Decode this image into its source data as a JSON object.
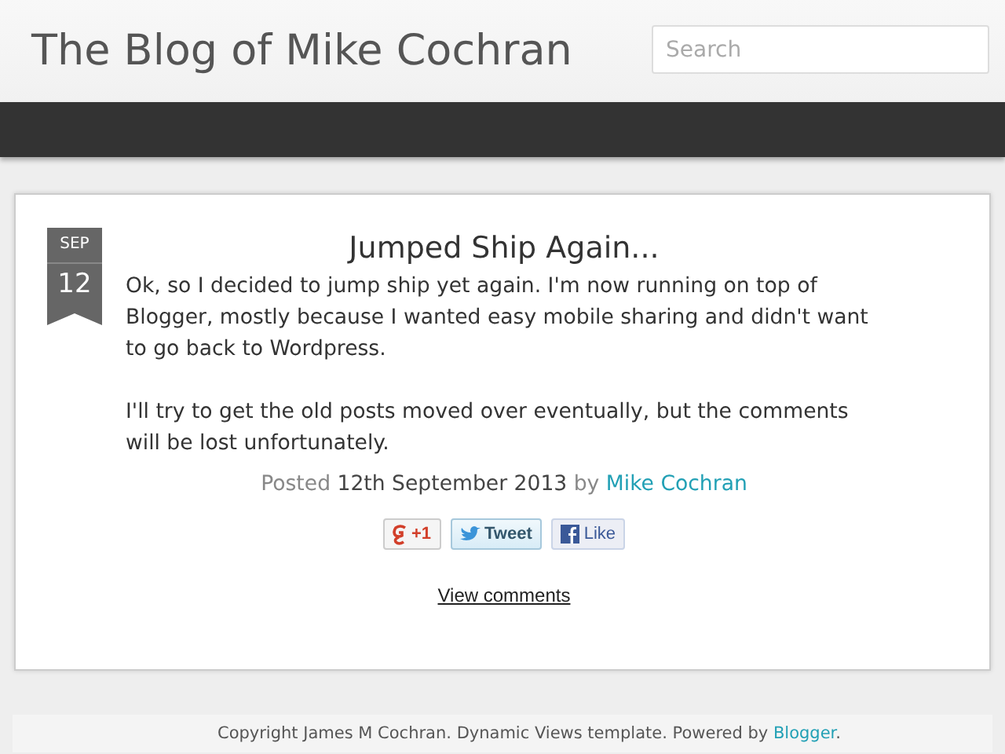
{
  "header": {
    "title": "The Blog of Mike Cochran",
    "search": {
      "placeholder": "Search"
    }
  },
  "post": {
    "date": {
      "month": "SEP",
      "day": "12"
    },
    "title": "Jumped Ship Again...",
    "paragraphs": [
      "Ok, so I decided to jump ship yet again. I'm now running on top of Blogger, mostly because I wanted easy mobile sharing and didn't want to go back to Wordpress.",
      "I'll try to get the old posts moved over eventually, but the comments will be lost unfortunately."
    ],
    "byline": {
      "posted": "Posted",
      "date": "12th September 2013",
      "by": "by",
      "author": "Mike Cochran"
    },
    "share_buttons": [
      {
        "kind": "plusone",
        "label": "+1"
      },
      {
        "kind": "tweet",
        "label": "Tweet"
      },
      {
        "kind": "like",
        "label": "Like"
      }
    ],
    "comments_link": "View comments"
  },
  "footer": {
    "text": "Copyright James M Cochran. Dynamic Views template. Powered by ",
    "link": "Blogger",
    "after": "."
  }
}
